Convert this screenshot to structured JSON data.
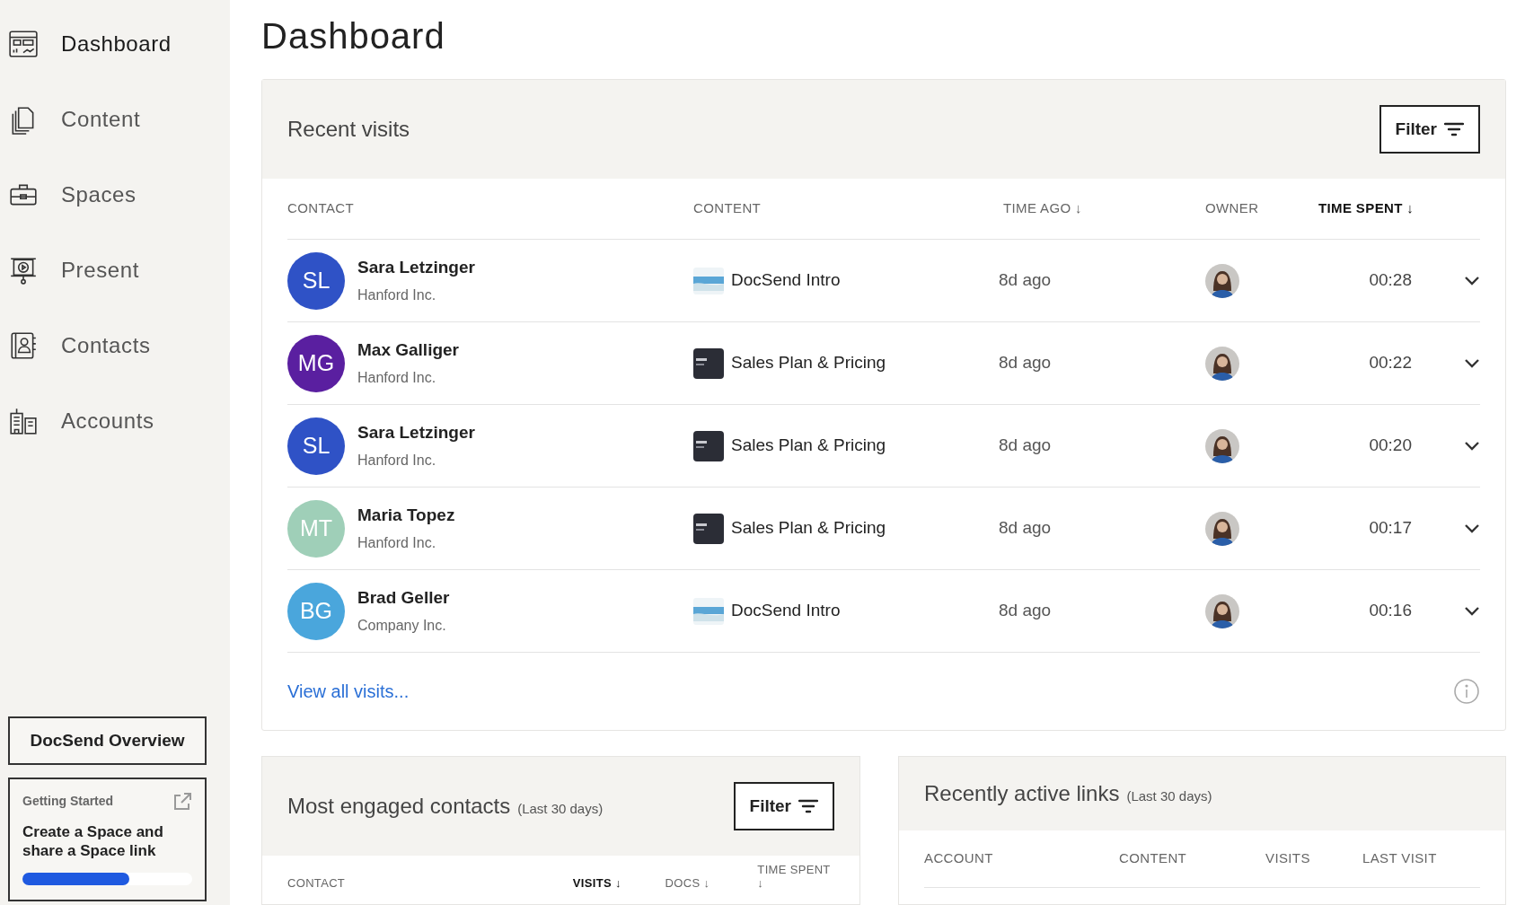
{
  "sidebar": {
    "items": [
      {
        "label": "Dashboard",
        "selected": true
      },
      {
        "label": "Content",
        "selected": false
      },
      {
        "label": "Spaces",
        "selected": false
      },
      {
        "label": "Present",
        "selected": false
      },
      {
        "label": "Contacts",
        "selected": false
      },
      {
        "label": "Accounts",
        "selected": false
      }
    ],
    "overview_button": "DocSend Overview",
    "getting_started": {
      "title": "Getting Started",
      "task": "Create a Space and share a Space link",
      "level": 0.63
    }
  },
  "page_title": "Dashboard",
  "recent_visits": {
    "title": "Recent visits",
    "filter": "Filter",
    "columns": [
      {
        "label": "CONTACT",
        "sorted": false
      },
      {
        "label": "CONTENT",
        "sorted": false
      },
      {
        "label": "TIME AGO ↓",
        "sorted": false
      },
      {
        "label": "OWNER",
        "sorted": false
      },
      {
        "label": "TIME SPENT ↓",
        "sorted": true
      }
    ],
    "rows": [
      {
        "initials": "SL",
        "color": "#2f52c6",
        "name": "Sara Letzinger",
        "company": "Hanford Inc.",
        "kind": "light",
        "content": "DocSend Intro",
        "time_ago": "8d ago",
        "time_spent": "00:28",
        "expanded": false
      },
      {
        "initials": "MG",
        "color": "#5a1fa0",
        "name": "Max Galliger",
        "company": "Hanford Inc.",
        "kind": "dark",
        "content": "Sales Plan & Pricing",
        "time_ago": "8d ago",
        "time_spent": "00:22",
        "expanded": false
      },
      {
        "initials": "SL",
        "color": "#2f52c6",
        "name": "Sara Letzinger",
        "company": "Hanford Inc.",
        "kind": "dark",
        "content": "Sales Plan & Pricing",
        "time_ago": "8d ago",
        "time_spent": "00:20",
        "expanded": false
      },
      {
        "initials": "MT",
        "color": "#9fcfb8",
        "name": "Maria Topez",
        "company": "Hanford Inc.",
        "kind": "dark",
        "content": "Sales Plan & Pricing",
        "time_ago": "8d ago",
        "time_spent": "00:17",
        "expanded": false
      },
      {
        "initials": "BG",
        "color": "#4aa6dc",
        "name": "Brad Geller",
        "company": "Company Inc.",
        "kind": "light",
        "content": "DocSend Intro",
        "time_ago": "8d ago",
        "time_spent": "00:16",
        "expanded": false
      }
    ],
    "view_all": "View all visits..."
  },
  "most_engaged": {
    "title": "Most engaged contacts",
    "subtitle": "(Last 30 days)",
    "filter": "Filter",
    "columns": [
      {
        "label": "CONTACT",
        "sorted": false
      },
      {
        "label": "VISITS ↓",
        "sorted": true
      },
      {
        "label": "DOCS ↓",
        "sorted": false
      },
      {
        "label": "TIME SPENT ↓",
        "sorted": false
      }
    ]
  },
  "recent_links": {
    "title": "Recently active links",
    "subtitle": "(Last 30 days)",
    "columns": [
      {
        "label": "ACCOUNT"
      },
      {
        "label": "CONTENT"
      },
      {
        "label": "VISITS"
      },
      {
        "label": "LAST VISIT"
      }
    ]
  }
}
